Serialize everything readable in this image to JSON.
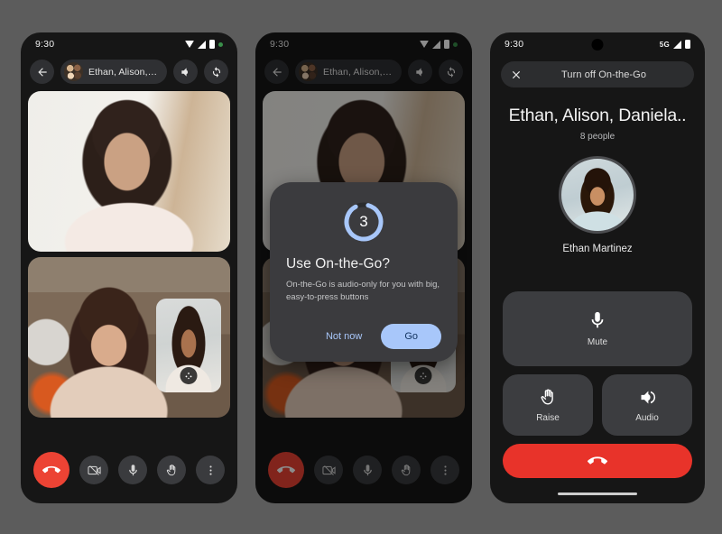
{
  "background_color": "#5c5c5c",
  "phone1": {
    "name": "google-meet-in-call",
    "status_bar": {
      "clock": "9:30",
      "icons": [
        "wifi-icon",
        "signal-icon",
        "battery-icon",
        "privacy-dot-icon"
      ]
    },
    "header": {
      "back_icon": "back-arrow-icon",
      "avatar": "group-avatar",
      "title": "Ethan, Alison, Dani...",
      "speaker_icon": "speaker-icon",
      "switch_camera_icon": "switch-camera-icon"
    },
    "tiles": [
      {
        "name": "video-tile-remote-1"
      },
      {
        "name": "video-tile-remote-2",
        "pip": {
          "name": "self-view-pip",
          "effects_icon": "effects-icon"
        }
      }
    ],
    "callbar": [
      {
        "name": "end-call-button",
        "icon": "end-call-icon",
        "color": "#ec4334"
      },
      {
        "name": "camera-toggle-button",
        "icon": "camera-off-icon"
      },
      {
        "name": "mic-toggle-button",
        "icon": "microphone-icon"
      },
      {
        "name": "raise-hand-button",
        "icon": "raise-hand-icon"
      },
      {
        "name": "more-options-button",
        "icon": "more-vertical-icon"
      }
    ]
  },
  "phone2": {
    "name": "google-meet-on-the-go-prompt",
    "status_bar": {
      "clock": "9:30",
      "icons": [
        "wifi-icon",
        "signal-icon",
        "battery-icon",
        "privacy-dot-icon"
      ]
    },
    "header": {
      "back_icon": "back-arrow-icon",
      "avatar": "group-avatar",
      "title": "Ethan, Alison, Dani...",
      "speaker_icon": "speaker-icon",
      "switch_camera_icon": "switch-camera-icon"
    },
    "dialog": {
      "countdown": "3",
      "countdown_progress": 0.88,
      "ring_color": "#a8c7fa",
      "title": "Use On-the-Go?",
      "body": "On-the-Go is audio-only for you with big, easy-to-press buttons",
      "secondary_button": "Not now",
      "primary_button": "Go"
    }
  },
  "phone3": {
    "name": "google-meet-on-the-go-mode",
    "status_bar": {
      "clock": "9:30",
      "icons": [
        "5g-icon",
        "signal-icon",
        "battery-icon"
      ],
      "network": "5G"
    },
    "top_bar": {
      "close_icon": "close-icon",
      "label": "Turn off On-the-Go"
    },
    "call_title": "Ethan, Alison, Daniela..",
    "participant_count": "8 people",
    "speaker": {
      "avatar": "participant-avatar",
      "name": "Ethan Martinez"
    },
    "controls": [
      {
        "name": "mute-button",
        "label": "Mute",
        "icon": "microphone-icon",
        "size": "large"
      },
      {
        "name": "raise-hand-button",
        "label": "Raise",
        "icon": "raise-hand-icon",
        "size": "half"
      },
      {
        "name": "audio-button",
        "label": "Audio",
        "icon": "speaker-icon",
        "size": "half"
      }
    ],
    "end_call": {
      "name": "end-call-button",
      "icon": "end-call-icon",
      "color": "#e8332a"
    }
  }
}
